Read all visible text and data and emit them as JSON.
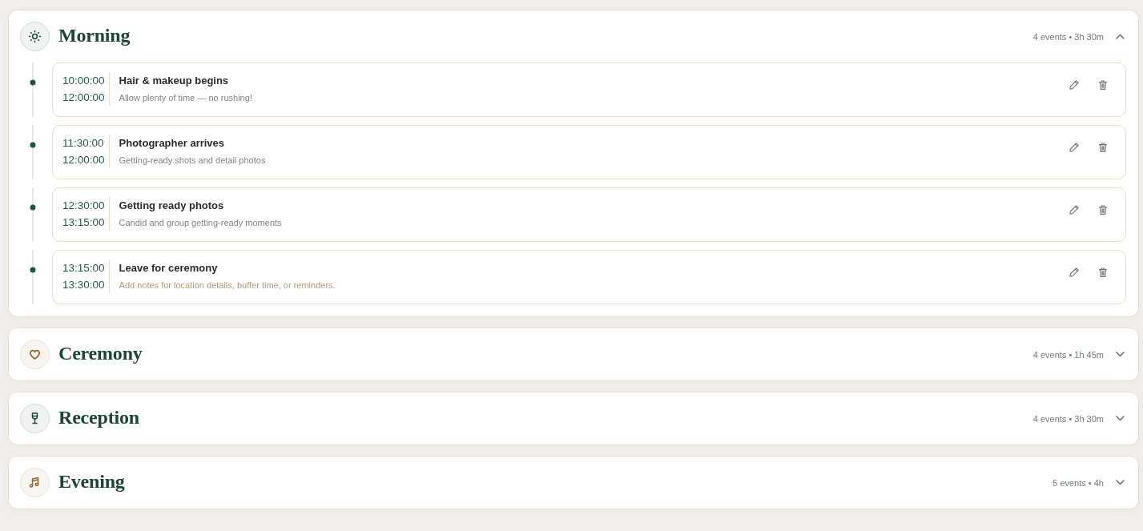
{
  "sections": [
    {
      "title": "Morning",
      "summary": "4 events • 3h 30m",
      "expanded": true,
      "color": "#1e4a3a",
      "events": [
        {
          "start": "10:00:00",
          "end": "12:00:00",
          "title": "Hair & makeup begins",
          "note": "Allow plenty of time — no rushing!"
        },
        {
          "start": "11:30:00",
          "end": "12:00:00",
          "title": "Photographer arrives",
          "note": "Getting-ready shots and detail photos"
        },
        {
          "start": "12:30:00",
          "end": "13:15:00",
          "title": "Getting ready photos",
          "note": "Candid and group getting-ready moments"
        },
        {
          "start": "13:15:00",
          "end": "13:30:00",
          "title": "Leave for ceremony",
          "placeholder": "Add notes for location details, buffer time, or reminders."
        }
      ]
    },
    {
      "title": "Ceremony",
      "summary": "4 events • 1h 45m",
      "expanded": false,
      "color": "#946434"
    },
    {
      "title": "Reception",
      "summary": "4 events • 3h 30m",
      "expanded": false,
      "color": "#1e4a3a"
    },
    {
      "title": "Evening",
      "summary": "5 events • 4h",
      "expanded": false,
      "color": "#946434"
    }
  ]
}
